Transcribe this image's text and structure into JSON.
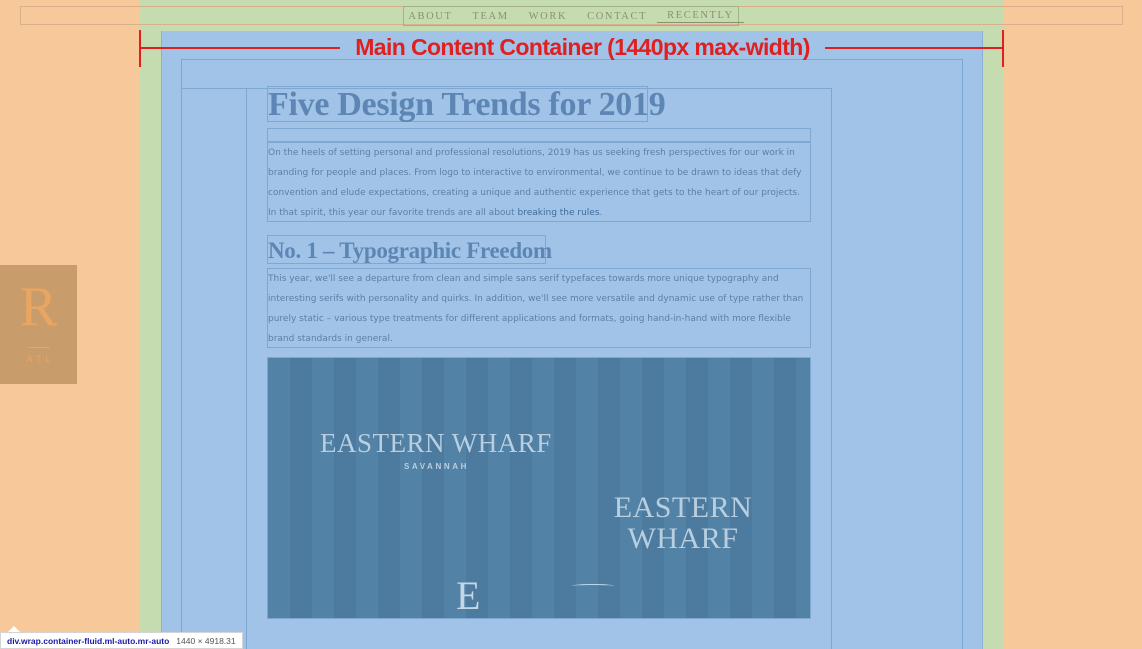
{
  "nav": {
    "items": [
      {
        "label": "ABOUT"
      },
      {
        "label": "TEAM"
      },
      {
        "label": "WORK"
      },
      {
        "label": "CONTACT"
      },
      {
        "label": "RECENTLY",
        "active": true
      }
    ]
  },
  "annotation": {
    "label": "Main Content Container (1440px max-width)",
    "color": "#e02020"
  },
  "side_logo": {
    "letter": "R",
    "sub": "ATL"
  },
  "article": {
    "title": "Five Design Trends for 2019",
    "intro": "On the heels of setting personal and professional resolutions, 2019 has us seeking fresh perspectives for our work in branding for people and places. From logo to interactive to environmental, we continue to be drawn to ideas that defy convention and elude expectations, creating a unique and authentic experience that gets to the heart of our projects. In that spirit, this year our favorite trends are all about ",
    "intro_link": "breaking the rules",
    "intro_end": ".",
    "section1_title": "No. 1 – Typographic Freedom",
    "section1_body": "This year, we'll see a departure from clean and simple sans serif typefaces towards more unique typography and interesting serifs with personality and quirks. In addition, we'll see more versatile and dynamic use of type rather than purely static – various type treatments for different applications and formats, going hand-in-hand with more flexible brand standards in general."
  },
  "hero_image": {
    "wordmark_1": "EASTERN WHARF",
    "wordmark_1_sub": "SAVANNAH",
    "wordmark_2_line1": "EASTERN",
    "wordmark_2_line2": "WHARF",
    "monogram": "E"
  },
  "devtools": {
    "selector": "div.wrap.container-fluid.ml-auto.mr-auto",
    "dimensions": "1440 × 4918.31"
  },
  "colors": {
    "margin": "#f7c99a",
    "padding": "#c5dcb0",
    "content": "#a0c3e7",
    "annotation": "#e02020"
  }
}
